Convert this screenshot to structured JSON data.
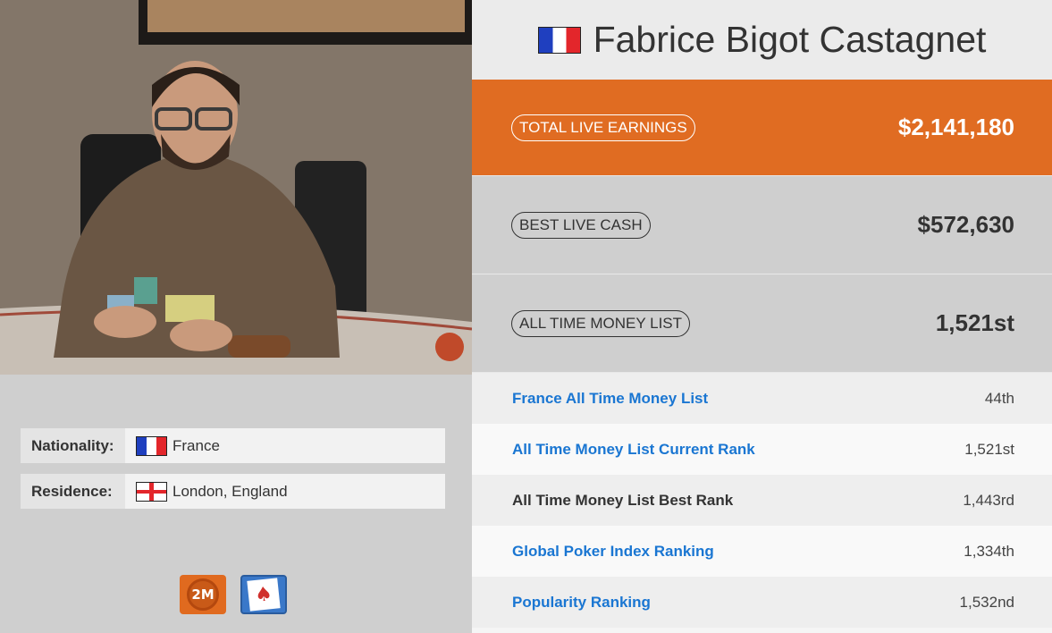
{
  "player": {
    "name": "Fabrice Bigot Castagnet"
  },
  "stats": {
    "total_live_earnings": {
      "label": "TOTAL LIVE EARNINGS",
      "value": "$2,141,180"
    },
    "best_live_cash": {
      "label": "BEST LIVE CASH",
      "value": "$572,630"
    },
    "all_time_money_list": {
      "label": "ALL TIME MONEY LIST",
      "value": "1,521st"
    }
  },
  "rankings": [
    {
      "label": "France All Time Money List",
      "value": "44th",
      "link": true
    },
    {
      "label": "All Time Money List Current Rank",
      "value": "1,521st",
      "link": true
    },
    {
      "label": "All Time Money List Best Rank",
      "value": "1,443rd",
      "link": false
    },
    {
      "label": "Global Poker Index Ranking",
      "value": "1,334th",
      "link": true
    },
    {
      "label": "Popularity Ranking",
      "value": "1,532nd",
      "link": true
    }
  ],
  "profile": {
    "nationality_label": "Nationality:",
    "nationality_value": "France",
    "residence_label": "Residence:",
    "residence_value": "London, England"
  },
  "badges": {
    "money_badge_text": "2M"
  },
  "colors": {
    "accent_orange": "#e06c22",
    "link_blue": "#1a76d2"
  }
}
